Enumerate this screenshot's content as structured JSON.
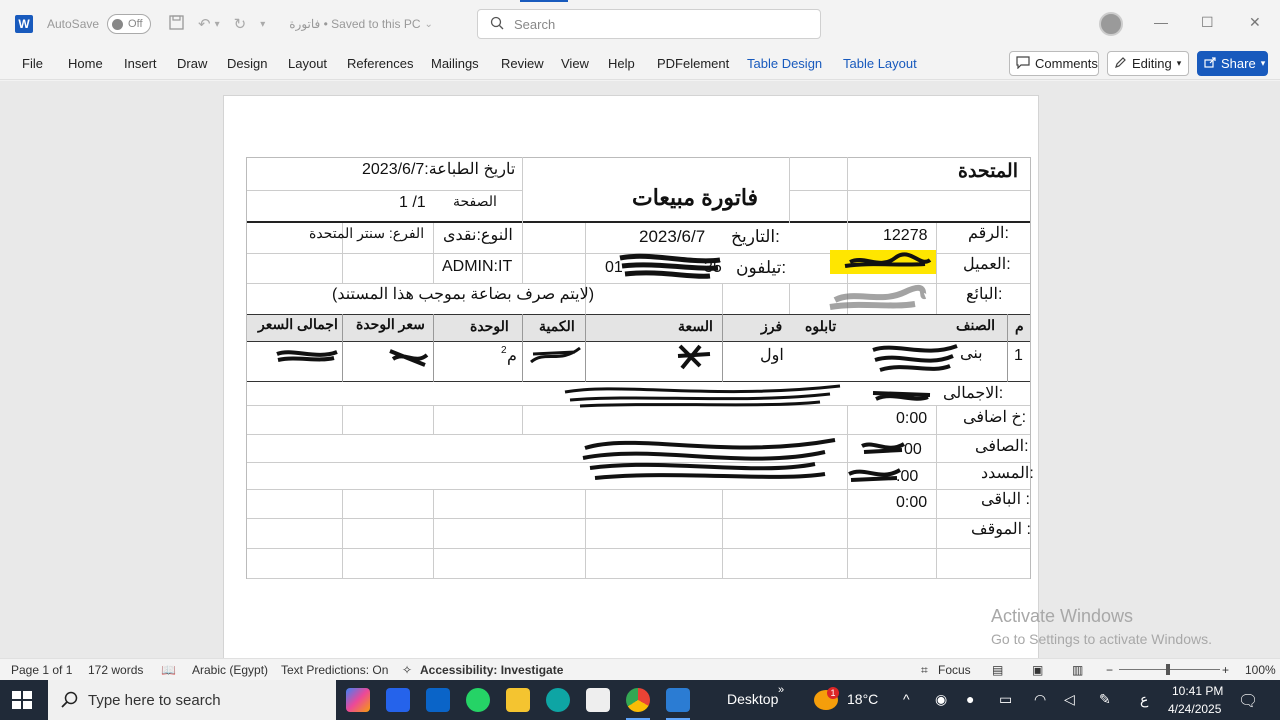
{
  "titlebar": {
    "app_logo": "W",
    "autosave_label": "AutoSave",
    "autosave_state": "Off",
    "doc_title": "فاتورة  •  Saved to this PC",
    "search_placeholder": "Search"
  },
  "ribbon": {
    "tabs": [
      "File",
      "Home",
      "Insert",
      "Draw",
      "Design",
      "Layout",
      "References",
      "Mailings",
      "Review",
      "View",
      "Help",
      "PDFelement",
      "Table Design",
      "Table Layout"
    ],
    "comments_label": "Comments",
    "editing_label": "Editing",
    "share_label": "Share"
  },
  "invoice": {
    "company": "المتحدة",
    "title": "فاتورة مبيعات",
    "print_date": "تاريخ الطباعة:2023/6/7",
    "page_label": "الصفحة",
    "page_value": "1 /1",
    "number_label": "الرقم:",
    "number_value": "12278",
    "date_label": "التاريخ:",
    "date_value": "2023/6/7",
    "type": "النوع:نقدى",
    "branch": "الفرع: سنتر المتحدة",
    "customer_label": "العميل:",
    "phone_label": "تيلفون:",
    "phone_partial_start": "01",
    "phone_partial_end": "35",
    "user": "ADMIN:IT",
    "seller_label": "البائع:",
    "note": "(لايتم صرف بضاعة بموجب هذا المستند)",
    "headers": [
      "م",
      "الصنف",
      "تابلوه",
      "فرز",
      "السعة",
      "الكمية",
      "الوحدة",
      "سعر الوحدة",
      "اجمالى السعر"
    ],
    "row": {
      "index": "1",
      "item": "بنى",
      "grade": "اول",
      "unit": "م",
      "unit_sup": "2"
    },
    "total_label": "الاجمالى:",
    "extra_tax_label": "خ اضافى:",
    "extra_tax_value": "0:00",
    "net_label": "الصافى:",
    "net_value_suffix": "00",
    "paid_label": "المسدد:",
    "paid_value_suffix": ".00",
    "remaining_label": "الباقى :",
    "remaining_value": "0:00",
    "status_label": "الموقف :"
  },
  "watermark": {
    "line1": "Activate Windows",
    "line2": "Go to Settings to activate Windows."
  },
  "statusbar": {
    "page": "Page 1 of 1",
    "words": "172 words",
    "language": "Arabic (Egypt)",
    "predictions": "Text Predictions: On",
    "accessibility": "Accessibility: Investigate",
    "focus": "Focus",
    "zoom": "100%"
  },
  "taskbar": {
    "search_placeholder": "Type here to search",
    "desktop_label": "Desktop",
    "weather": "18°C",
    "notif_count": "1",
    "lang": "ع",
    "time": "10:41 PM",
    "date": "4/24/2025"
  }
}
